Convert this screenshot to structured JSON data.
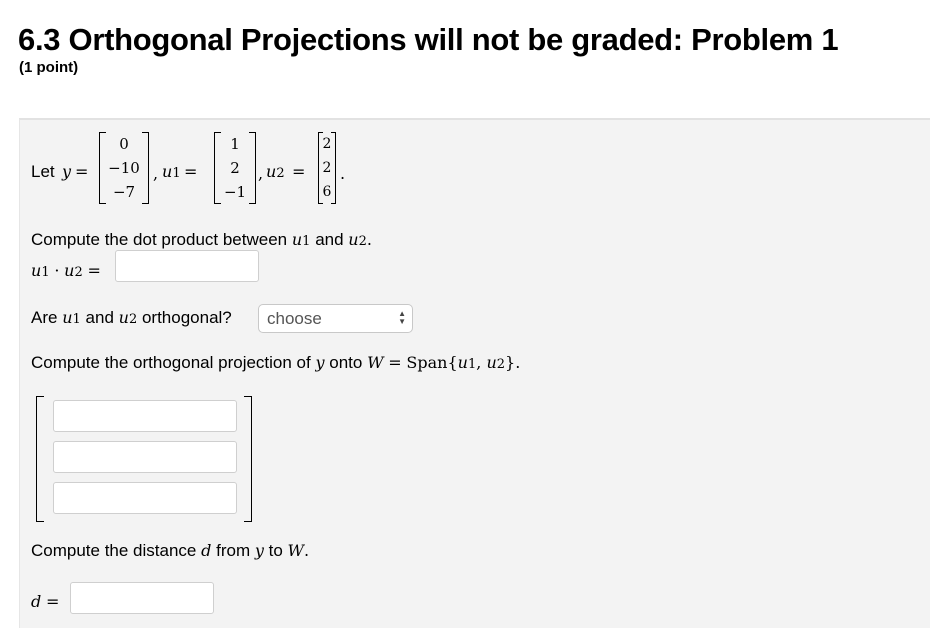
{
  "header": {
    "title": "6.3 Orthogonal Projections will not be graded: Problem 1",
    "points": "(1 point)"
  },
  "problem": {
    "let_label": "Let",
    "y_var": "y",
    "u_var": "u",
    "equals": "=",
    "comma": ",",
    "period": ".",
    "sub1": "1",
    "sub2": "2",
    "vector_y": [
      "0",
      "−10",
      "−7"
    ],
    "vector_u1": [
      "1",
      "2",
      "−1"
    ],
    "vector_u2": [
      "2",
      "2",
      "6"
    ],
    "q1_text_a": "Compute the dot product between",
    "q1_and": "and",
    "dot": "·",
    "q2_text_a": "Are",
    "q2_and": "and",
    "q2_text_b": "orthogonal?",
    "select_value": "choose",
    "q3_text_a": "Compute the orthogonal projection of",
    "q3_text_b": "onto",
    "w_var": "W",
    "span_text": "Span{",
    "span_close": "}",
    "q4_text_a": "Compute the distance",
    "d_var": "d",
    "q4_from": "from",
    "q4_to": "to",
    "icons": {
      "select_arrows": "updown-arrows-icon"
    }
  }
}
